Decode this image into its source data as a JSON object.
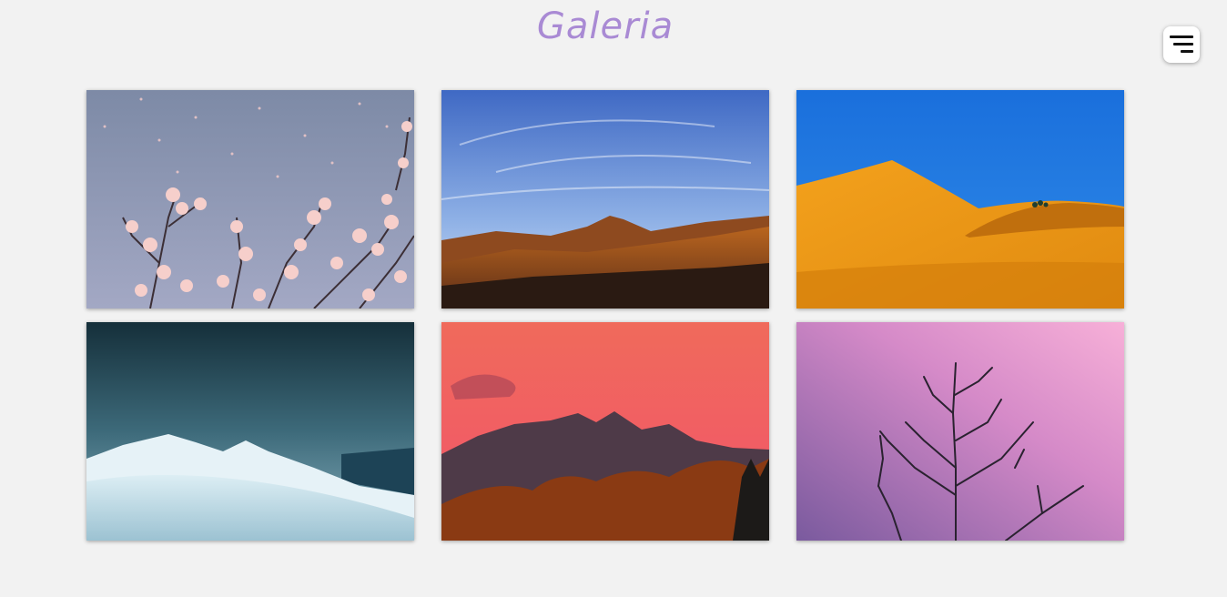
{
  "header": {
    "title": "Galeria"
  },
  "menu": {
    "icon": "menu-icon"
  },
  "gallery": {
    "photos": [
      {
        "subject": "blossom-branches-icon"
      },
      {
        "subject": "mountain-landscape-icon"
      },
      {
        "subject": "desert-dune-icon"
      },
      {
        "subject": "snowy-mountain-icon"
      },
      {
        "subject": "red-sky-mountain-icon"
      },
      {
        "subject": "bare-tree-pink-sky-icon"
      }
    ]
  },
  "colors": {
    "background": "#f2f2f2",
    "title": "#a98ad4",
    "menu_bg": "#ffffff"
  }
}
